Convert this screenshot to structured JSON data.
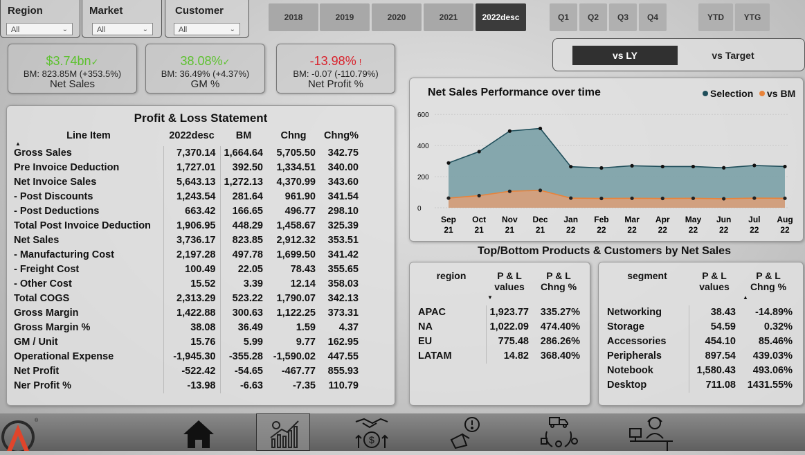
{
  "slicers": [
    {
      "title": "Region",
      "value": "All"
    },
    {
      "title": "Market",
      "value": "All"
    },
    {
      "title": "Customer",
      "value": "All"
    }
  ],
  "years": [
    "2018",
    "2019",
    "2020",
    "2021",
    "2022desc"
  ],
  "active_year": "2022desc",
  "quarters": [
    "Q1",
    "Q2",
    "Q3",
    "Q4"
  ],
  "period_buttons": [
    "YTD",
    "YTG"
  ],
  "kpis": [
    {
      "value": "$3.74bn",
      "mark": "✓",
      "bm": "BM: 823.85M (+353.5%)",
      "label": "Net Sales",
      "color": "#5cc12e"
    },
    {
      "value": "38.08%",
      "mark": "✓",
      "bm": "BM: 36.49% (+4.37%)",
      "label": "GM %",
      "color": "#5cc12e"
    },
    {
      "value": "-13.98%",
      "mark": "!",
      "bm": "BM: -0.07 (-110.79%)",
      "label": "Net Profit %",
      "color": "#d9232d"
    }
  ],
  "toggle": {
    "active": "vs LY",
    "inactive": "vs Target"
  },
  "pl": {
    "title": "Profit & Loss Statement",
    "headers": [
      "Line Item",
      "2022desc",
      "BM",
      "Chng",
      "Chng%"
    ],
    "rows": [
      [
        "Gross Sales",
        "7,370.14",
        "1,664.64",
        "5,705.50",
        "342.75"
      ],
      [
        "Pre Invoice Deduction",
        "1,727.01",
        "392.50",
        "1,334.51",
        "340.00"
      ],
      [
        "Net Invoice Sales",
        "5,643.13",
        "1,272.13",
        "4,370.99",
        "343.60"
      ],
      [
        "- Post Discounts",
        "1,243.54",
        "281.64",
        "961.90",
        "341.54"
      ],
      [
        "- Post Deductions",
        "663.42",
        "166.65",
        "496.77",
        "298.10"
      ],
      [
        "Total Post Invoice Deduction",
        "1,906.95",
        "448.29",
        "1,458.67",
        "325.39"
      ],
      [
        "Net Sales",
        "3,736.17",
        "823.85",
        "2,912.32",
        "353.51"
      ],
      [
        "- Manufacturing Cost",
        "2,197.28",
        "497.78",
        "1,699.50",
        "341.42"
      ],
      [
        "- Freight Cost",
        "100.49",
        "22.05",
        "78.43",
        "355.65"
      ],
      [
        "- Other Cost",
        "15.52",
        "3.39",
        "12.14",
        "358.03"
      ],
      [
        "Total COGS",
        "2,313.29",
        "523.22",
        "1,790.07",
        "342.13"
      ],
      [
        "Gross Margin",
        "1,422.88",
        "300.63",
        "1,122.25",
        "373.31"
      ],
      [
        "Gross Margin %",
        "38.08",
        "36.49",
        "1.59",
        "4.37"
      ],
      [
        "GM / Unit",
        "15.76",
        "5.99",
        "9.77",
        "162.95"
      ],
      [
        "Operational Expense",
        "-1,945.30",
        "-355.28",
        "-1,590.02",
        "447.55"
      ],
      [
        "Net Profit",
        "-522.42",
        "-54.65",
        "-467.77",
        "855.93"
      ],
      [
        "Ner Profit %",
        "-13.98",
        "-6.63",
        "-7.35",
        "110.79"
      ]
    ]
  },
  "chart_data": {
    "type": "area",
    "title": "Net Sales Performance over time",
    "legend": {
      "position": "top-right"
    },
    "categories": [
      "Sep 21",
      "Oct 21",
      "Nov 21",
      "Dec 21",
      "Jan 22",
      "Feb 22",
      "Mar 22",
      "Apr 22",
      "May 22",
      "Jun 22",
      "Jul 22",
      "Aug 22"
    ],
    "series": [
      {
        "name": "Selection",
        "color": "#1f4e5a",
        "values": [
          288,
          361,
          493,
          510,
          264,
          256,
          270,
          265,
          265,
          257,
          272,
          265
        ]
      },
      {
        "name": "vs BM",
        "color": "#e8833a",
        "values": [
          62,
          78,
          106,
          112,
          62,
          60,
          61,
          60,
          61,
          58,
          62,
          61
        ]
      }
    ],
    "yticks": [
      0,
      200,
      400,
      600
    ],
    "ylim": [
      0,
      650
    ],
    "grid": true
  },
  "section_title": "Top/Bottom Products & Customers by Net Sales",
  "region_table": {
    "headers": [
      "region",
      "P & L values",
      "P & L Chng %"
    ],
    "rows": [
      [
        "APAC",
        "1,923.77",
        "335.27%"
      ],
      [
        "NA",
        "1,022.09",
        "474.40%"
      ],
      [
        "EU",
        "775.48",
        "286.26%"
      ],
      [
        "LATAM",
        "14.82",
        "368.40%"
      ]
    ]
  },
  "segment_table": {
    "headers": [
      "segment",
      "P & L values",
      "P & L Chng %"
    ],
    "rows": [
      [
        "Networking",
        "38.43",
        "-14.89%"
      ],
      [
        "Storage",
        "54.59",
        "0.32%"
      ],
      [
        "Accessories",
        "454.10",
        "85.46%"
      ],
      [
        "Peripherals",
        "897.54",
        "439.03%"
      ],
      [
        "Notebook",
        "1,580.43",
        "493.06%"
      ],
      [
        "Desktop",
        "711.08",
        "1431.55%"
      ]
    ]
  },
  "nav": [
    "home-icon",
    "analytics-icon",
    "finance-handshake-icon",
    "marketing-icon",
    "supply-chain-icon",
    "executive-icon"
  ]
}
